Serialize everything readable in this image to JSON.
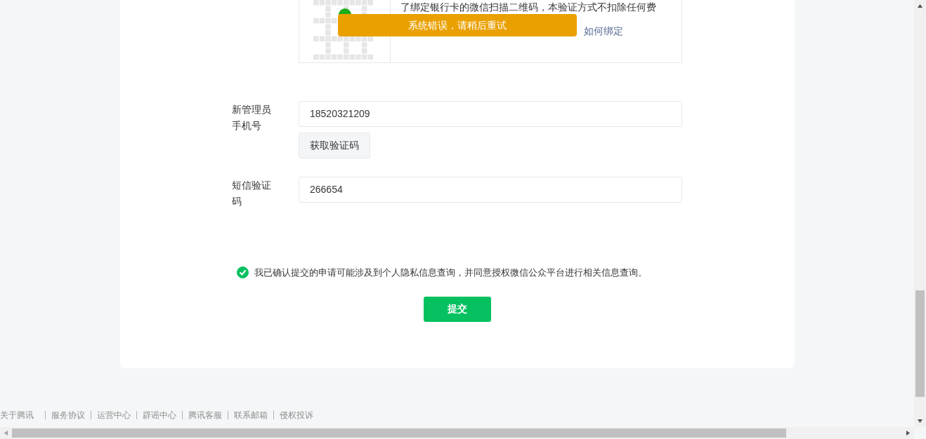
{
  "verify_box": {
    "description": "了绑定银行卡的微信扫描二维码，本验证方式不扣除任何费",
    "link": "如何绑定"
  },
  "toast": {
    "message": "系统错误，请稍后重试"
  },
  "fields": [
    {
      "label": "新管理员手机号",
      "value": "18520321209",
      "button": "获取验证码"
    },
    {
      "label": "短信验证码",
      "value": "266654"
    }
  ],
  "agreement": {
    "checked": true,
    "text": "我已确认提交的申请可能涉及到个人隐私信息查询，并同意授权微信公众平台进行相关信息查询。"
  },
  "submit": "提交",
  "footer_links": [
    "关于腾讯",
    "服务协议",
    "运营中心",
    "辟谣中心",
    "腾讯客服",
    "联系邮箱",
    "侵权投诉"
  ]
}
